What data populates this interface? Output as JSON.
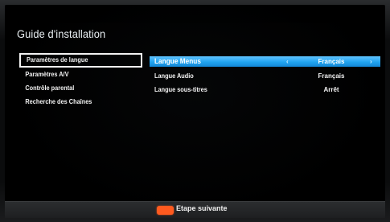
{
  "screen": {
    "title": "Guide d'installation"
  },
  "left_menu": {
    "items": [
      {
        "label": "Paramètres de langue",
        "selected": true
      },
      {
        "label": "Paramètres A/V",
        "selected": false
      },
      {
        "label": "Contrôle parental",
        "selected": false
      },
      {
        "label": "Recherche des Chaînes",
        "selected": false
      }
    ]
  },
  "right_panel": {
    "rows": [
      {
        "label": "Langue Menus",
        "value": "Français",
        "highlighted": true
      },
      {
        "label": "Langue Audio",
        "value": "Français",
        "highlighted": false
      },
      {
        "label": "Langue sous-titres",
        "value": "Arrêt",
        "highlighted": false
      }
    ],
    "arrow_left": "‹",
    "arrow_right": "›"
  },
  "footer": {
    "next_label": "Etape suivante",
    "red_key_color": "#ff5a1f"
  },
  "colors": {
    "highlight_blue": "#21a4f0",
    "background": "#000000"
  }
}
